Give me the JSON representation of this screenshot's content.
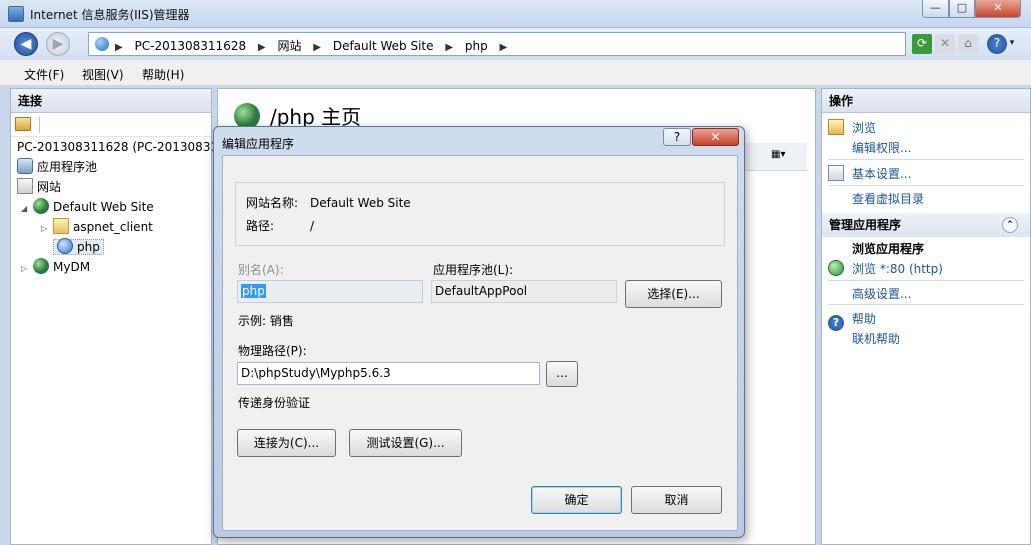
{
  "window": {
    "title": "Internet 信息服务(IIS)管理器",
    "min": "—",
    "max": "□",
    "close": "✕"
  },
  "toolbar": {
    "back": "◀",
    "forward": "▶",
    "breadcrumb": [
      "PC-201308311628",
      "网站",
      "Default Web Site",
      "php"
    ],
    "help_icon": "?",
    "help_dropdown": "▾"
  },
  "menu": {
    "file": "文件(F)",
    "view": "视图(V)",
    "help": "帮助(H)"
  },
  "left_panel": {
    "header": "连接",
    "tree": {
      "server": "PC-201308311628 (PC-201308311",
      "app_pools": "应用程序池",
      "sites": "网站",
      "default_site": "Default Web Site",
      "aspnet_client": "aspnet_client",
      "php": "php",
      "mydm": "MyDM"
    }
  },
  "center": {
    "title": "/php 主页",
    "view_icon": "▦▾"
  },
  "right_panel": {
    "header": "操作",
    "browse": "浏览",
    "edit_permissions": "编辑权限...",
    "basic_settings": "基本设置...",
    "view_virtual_dirs": "查看虚拟目录",
    "manage_app_header": "管理应用程序",
    "collapse": "⌃",
    "browse_app": "浏览应用程序",
    "browse_port": "浏览 *:80 (http)",
    "advanced_settings": "高级设置...",
    "help": "帮助",
    "online_help": "联机帮助",
    "help_glyph": "?"
  },
  "dialog": {
    "title": "编辑应用程序",
    "help_button": "?",
    "close_button": "✕",
    "site_name_label": "网站名称:",
    "site_name_value": "Default Web Site",
    "path_label": "路径:",
    "path_value": "/",
    "alias_label": "别名(A):",
    "alias_value": "php",
    "app_pool_label": "应用程序池(L):",
    "app_pool_value": "DefaultAppPool",
    "select_button": "选择(E)...",
    "example_text": "示例: 销售",
    "physical_path_label": "物理路径(P):",
    "physical_path_value": "D:\\phpStudy\\Myphp5.6.3",
    "browse_button": "...",
    "pass_through_auth": "传递身份验证",
    "connect_as_button": "连接为(C)...",
    "test_settings_button": "测试设置(G)...",
    "ok_button": "确定",
    "cancel_button": "取消"
  }
}
